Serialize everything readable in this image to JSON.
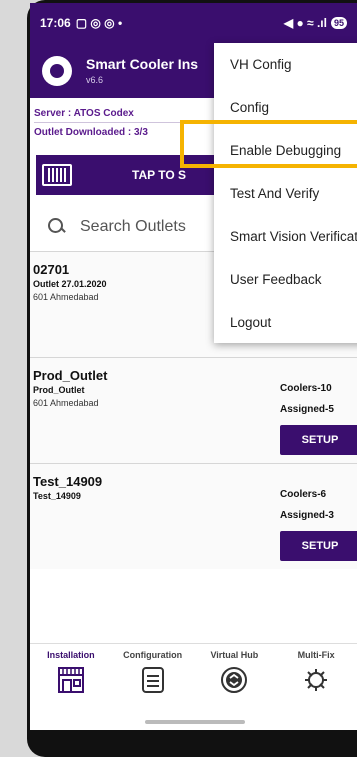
{
  "status_bar": {
    "time": "17:06",
    "battery": "95"
  },
  "app_bar": {
    "title": "Smart Cooler Ins",
    "version": "v6.6"
  },
  "info": {
    "server": "Server : ATOS Codex",
    "outlet_downloaded": "Outlet Downloaded : 3/3"
  },
  "tap_bar": {
    "label": "TAP TO S"
  },
  "search": {
    "placeholder": "Search Outlets"
  },
  "outlets": [
    {
      "code": "02701",
      "name": "Outlet 27.01.2020",
      "address": "601 Ahmedabad",
      "coolers": "",
      "assigned": "",
      "setup": ""
    },
    {
      "code": "Prod_Outlet",
      "name": "Prod_Outlet",
      "address": "601 Ahmedabad",
      "coolers": "Coolers-10",
      "assigned": "Assigned-5",
      "setup": "SETUP"
    },
    {
      "code": "Test_14909",
      "name": "Test_14909",
      "address": "",
      "coolers": "Coolers-6",
      "assigned": "Assigned-3",
      "setup": "SETUP"
    }
  ],
  "menu": {
    "items": [
      "VH Config",
      "Config",
      "Enable Debugging",
      "Test And Verify",
      "Smart Vision Verification",
      "User Feedback",
      "Logout"
    ]
  },
  "bottom_nav": {
    "items": [
      "Installation",
      "Configuration",
      "Virtual Hub",
      "Multi-Fix"
    ]
  },
  "colors": {
    "primary": "#3a0e6e",
    "highlight": "#f5b301"
  }
}
